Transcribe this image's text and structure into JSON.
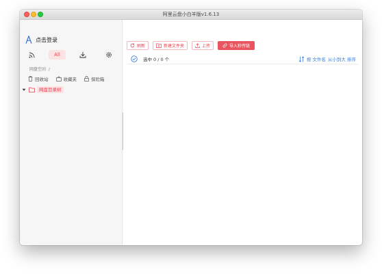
{
  "window": {
    "title": "阿里云盘小白羊版v1.6.13"
  },
  "sidebar": {
    "login_label": "点击登录",
    "tabs": [
      {
        "icon": "rss-icon",
        "label": ""
      },
      {
        "icon": "",
        "label": "All"
      },
      {
        "icon": "download-icon",
        "label": ""
      },
      {
        "icon": "gear-icon",
        "label": ""
      }
    ],
    "breadcrumb": {
      "root": "网盘空间",
      "sep": "/"
    },
    "links": [
      {
        "icon": "trash-icon",
        "label": "回收站"
      },
      {
        "icon": "favorites-icon",
        "label": "收藏夹"
      },
      {
        "icon": "lock-icon",
        "label": "保险箱"
      }
    ],
    "tree": {
      "root_label": "网盘目录树"
    }
  },
  "toolbar": {
    "refresh_label": "刷新",
    "new_folder_label": "新建文件夹",
    "upload_label": "上传",
    "import_label": "导入秒传链"
  },
  "listbar": {
    "select_prefix": "选中",
    "select_count": "0 / 0 个",
    "sort_label": "按 文件名",
    "sort_order": "从小到大 排序"
  },
  "colors": {
    "accent": "#e8424f",
    "accent_bg": "#fde2e4",
    "link_blue": "#3a7ed9"
  }
}
